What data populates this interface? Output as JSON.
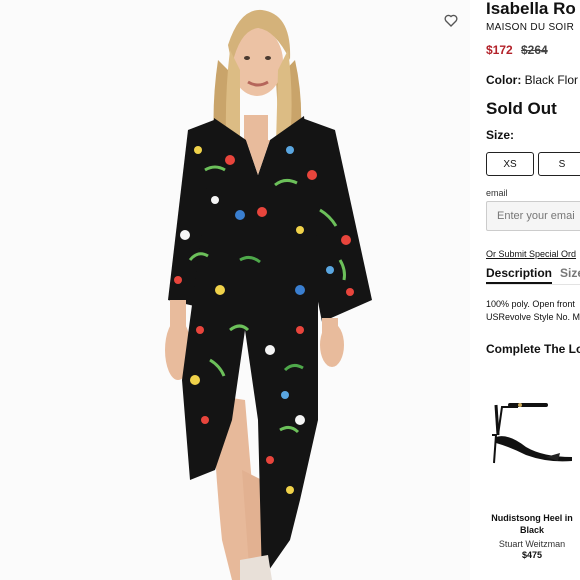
{
  "product": {
    "title": "Isabella Ro",
    "brand": "MAISON DU SOIR",
    "sale_price": "$172",
    "original_price": "$264",
    "color_label": "Color:",
    "color_value": "Black Flor",
    "status": "Sold Out",
    "size_label": "Size:",
    "sizes": [
      "XS",
      "S"
    ]
  },
  "notify": {
    "email_label": "email",
    "email_placeholder": "Enter your emai",
    "special_order_link": "Or Submit Special Ord"
  },
  "tabs": {
    "description": "Description",
    "size": "Size"
  },
  "description_lines": [
    "100% poly. Open front",
    "USRevolve Style No. M"
  ],
  "complete_the_look": {
    "heading": "Complete The Lo",
    "item": {
      "name_line1": "Nudistsong Heel in",
      "name_line2": "Black",
      "brand": "Stuart Weitzman",
      "price": "$475"
    }
  },
  "icons": {
    "wishlist": "heart-outline-icon"
  },
  "colors": {
    "sale_price": "#b3222a",
    "dress_base": "#141414"
  }
}
